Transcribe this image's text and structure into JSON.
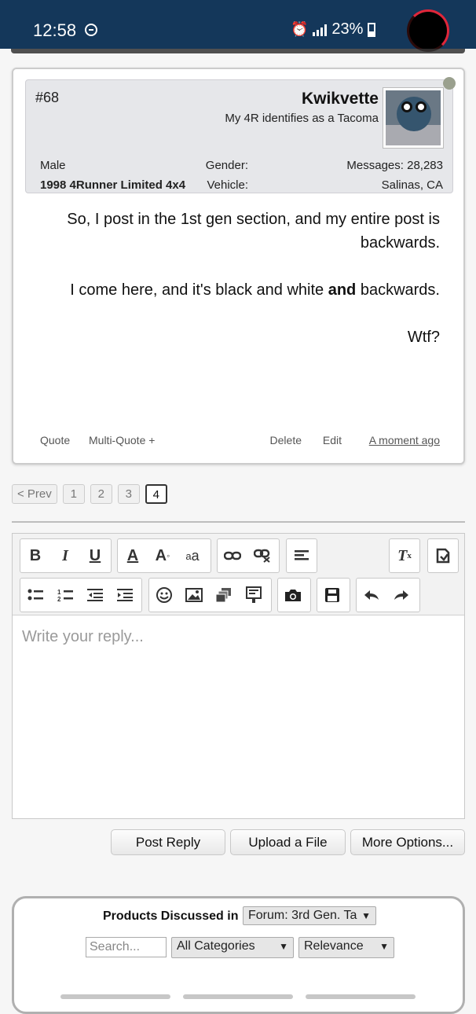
{
  "status": {
    "time": "12:58",
    "battery": "23%"
  },
  "post": {
    "username": "Kwikvette",
    "user_title": "My 4R identifies as a Tacoma",
    "post_number": "#68",
    "messages_label": "Messages:",
    "messages_value": "28,283",
    "location": "Salinas, CA",
    "gender_label": "Gender:",
    "gender_value": "Male",
    "vehicle_label": "Vehicle:",
    "vehicle_value": "1998 4Runner Limited 4x4",
    "body_line1": "So, I post in the 1st gen section, and my entire post is backwards.",
    "body_line2_pre": "I come here, and it's black and white ",
    "body_line2_bold": "and",
    "body_line2_post": " backwards.",
    "body_line3": "Wtf?",
    "time_ago": "A moment ago",
    "edit": "Edit",
    "delete": "Delete",
    "multi_quote": "Multi-Quote +",
    "quote": "Quote"
  },
  "pager": {
    "prev": "< Prev",
    "pages": [
      "1",
      "2",
      "3",
      "4"
    ],
    "current": "4"
  },
  "editor": {
    "placeholder": "Write your reply...",
    "bold": "B",
    "italic": "I",
    "underline": "U",
    "font_color": "A",
    "font_size": "A",
    "font_sub": "a"
  },
  "buttons": {
    "post_reply": "Post Reply",
    "upload": "Upload a File",
    "more": "More Options..."
  },
  "products": {
    "title": "Products Discussed in",
    "forum_select": "Forum: 3rd Gen. Ta",
    "search_placeholder": "Search...",
    "category": "All Categories",
    "sort": "Relevance"
  },
  "icons": {
    "status": [
      "dnd-icon",
      "alarm-icon",
      "signal-icon",
      "battery-icon"
    ],
    "toolbar": [
      "link-icon",
      "unlink-icon",
      "align-icon",
      "clear-format-icon",
      "paste-icon",
      "bullet-list-icon",
      "numbered-list-icon",
      "outdent-icon",
      "indent-icon",
      "smiley-icon",
      "image-icon",
      "media-icon",
      "code-icon",
      "camera-icon",
      "save-icon",
      "undo-icon",
      "redo-icon"
    ]
  }
}
